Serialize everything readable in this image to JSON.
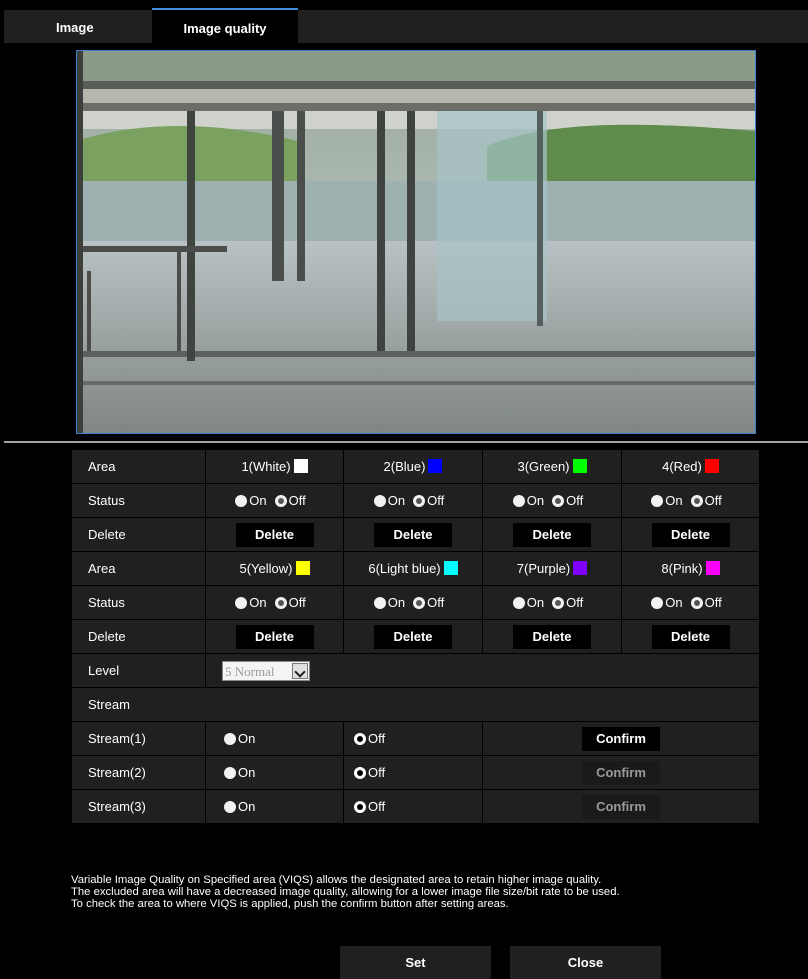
{
  "tabs": [
    {
      "label": "Image"
    },
    {
      "label": "Image quality"
    }
  ],
  "areas_row1": [
    {
      "label": "1(White)",
      "color": "#ffffff"
    },
    {
      "label": "2(Blue)",
      "color": "#0000ff"
    },
    {
      "label": "3(Green)",
      "color": "#00ff00"
    },
    {
      "label": "4(Red)",
      "color": "#ff0000"
    }
  ],
  "areas_row2": [
    {
      "label": "5(Yellow)",
      "color": "#ffff00"
    },
    {
      "label": "6(Light blue)",
      "color": "#00ffff"
    },
    {
      "label": "7(Purple)",
      "color": "#8000ff"
    },
    {
      "label": "8(Pink)",
      "color": "#ff00ff"
    }
  ],
  "labels": {
    "area": "Area",
    "status": "Status",
    "delete": "Delete",
    "level": "Level",
    "stream": "Stream",
    "stream1": "Stream(1)",
    "stream2": "Stream(2)",
    "stream3": "Stream(3)"
  },
  "radio": {
    "on": "On",
    "off": "Off"
  },
  "status_value": "Off",
  "buttons": {
    "delete": "Delete",
    "confirm": "Confirm",
    "set": "Set",
    "close": "Close"
  },
  "level": {
    "selected": "5 Normal"
  },
  "note": {
    "line1": "Variable Image Quality on Specified area (VIQS) allows the designated area to retain higher image quality.",
    "line2": "The excluded area will have a decreased image quality, allowing for a lower image file size/bit rate to be used.",
    "line3": "To check the area to where VIQS is applied, push the confirm button after setting areas."
  },
  "icons": {
    "dropdown": "chevron-down-icon"
  }
}
